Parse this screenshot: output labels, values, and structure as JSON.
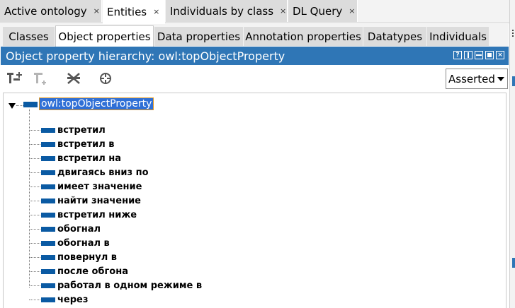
{
  "top_tabs": [
    {
      "label": "Active ontology",
      "close": "×",
      "active": false
    },
    {
      "label": "Entities",
      "close": "×",
      "active": true
    },
    {
      "label": "Individuals by class",
      "close": "×",
      "active": false
    },
    {
      "label": "DL Query",
      "close": "×",
      "active": false
    }
  ],
  "sub_tabs": [
    {
      "label": "Classes"
    },
    {
      "label": "Object properties"
    },
    {
      "label": "Data properties"
    },
    {
      "label": "Annotation properties"
    },
    {
      "label": "Datatypes"
    },
    {
      "label": "Individuals"
    }
  ],
  "view": {
    "title": "Object property hierarchy: owl:topObjectProperty",
    "help_label": "?"
  },
  "toolbar": {
    "icons": [
      "add-subproperty-icon",
      "add-sibling-property-icon",
      "delete-property-icon",
      "find-usage-icon"
    ]
  },
  "mode_select": {
    "value": "Asserted"
  },
  "tree": {
    "root": "owl:topObjectProperty",
    "children": [
      "встретил",
      "встретил в",
      "встретил на",
      "двигаясь вниз по",
      "имеет значение",
      "найти значение",
      "встретил ниже",
      "обогнал",
      "обогнал в",
      "повернул в",
      "после обгона",
      "работал в одном режиме в",
      "через"
    ]
  },
  "colors": {
    "accent": "#2f76b6",
    "property_icon": "#0a5aa3",
    "selection": "#2f6fd6"
  }
}
